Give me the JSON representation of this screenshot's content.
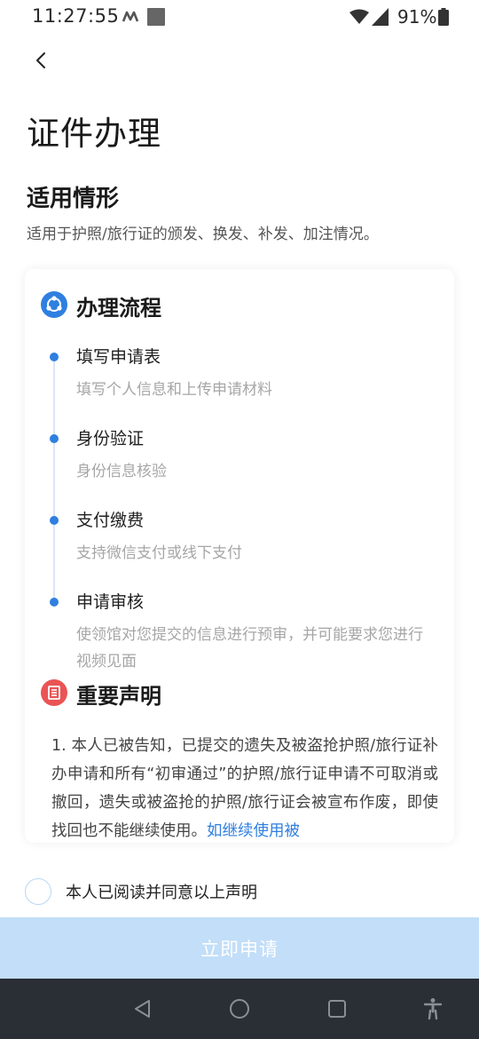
{
  "status_bar": {
    "time": "11:27:55",
    "battery": "91%"
  },
  "page": {
    "title": "证件办理"
  },
  "applicability": {
    "title": "适用情形",
    "description": "适用于护照/旅行证的颁发、换发、补发、加注情况。"
  },
  "process": {
    "title": "办理流程",
    "steps": [
      {
        "title": "填写申请表",
        "desc": "填写个人信息和上传申请材料"
      },
      {
        "title": "身份验证",
        "desc": "身份信息核验"
      },
      {
        "title": "支付缴费",
        "desc": "支持微信支付或线下支付"
      },
      {
        "title": "申请审核",
        "desc": "使领馆对您提交的信息进行预审，并可能要求您进行视频见面"
      }
    ]
  },
  "declaration": {
    "title": "重要声明",
    "text": "1. 本人已被告知，已提交的遗失及被盗抢护照/旅行证补办申请和所有“初审通过”的护照/旅行证申请不可取消或撤回，遗失或被盗抢的护照/旅行证会被宣布作废，即使找回也不能继续使用。",
    "link_text": "如继续使用被"
  },
  "agreement": {
    "label": "本人已阅读并同意以上声明",
    "checked": false
  },
  "apply_button": {
    "label": "立即申请"
  },
  "colors": {
    "accent": "#2f7fe0",
    "danger": "#ea5455",
    "button_disabled": "#c2def8"
  }
}
